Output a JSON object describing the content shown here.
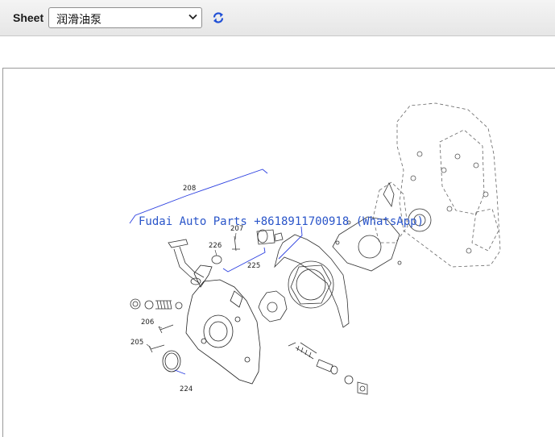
{
  "toolbar": {
    "sheet_label": "Sheet",
    "sheet_selected": "润滑油泵"
  },
  "diagram": {
    "watermark": "Fudai Auto Parts +8618911700918 (WhatsApp)",
    "callouts": [
      "208",
      "207",
      "226",
      "225",
      "206",
      "205",
      "224"
    ]
  },
  "colors": {
    "callout_leader": "#2b3fe0",
    "watermark": "#2a55c9",
    "refresh_icon": "#1f4fd6"
  }
}
